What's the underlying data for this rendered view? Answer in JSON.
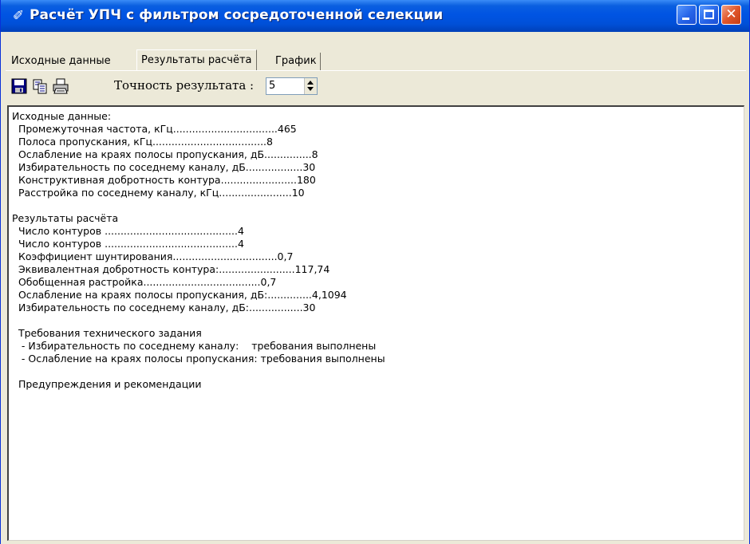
{
  "window": {
    "title": "Расчёт УПЧ с фильтром сосредоточенной селекции",
    "title_icon": "pencil-icon",
    "controls": [
      "minimize-icon",
      "maximize-icon",
      "close-icon"
    ]
  },
  "tabs": [
    {
      "label": "Исходные данные",
      "selected": false
    },
    {
      "label": "Результаты расчёта",
      "selected": true
    },
    {
      "label": "График",
      "selected": false
    }
  ],
  "toolbar": {
    "buttons": [
      "save-icon",
      "copy-icon",
      "print-icon"
    ],
    "precision_label": "Точность результата :",
    "precision_value": "5"
  },
  "results": {
    "text": "Исходные данные:\n  Промежуточная частота, кГц.................................465\n  Полоса пропускания, кГц....................................8\n  Ослабление на краях полосы пропускания, дБ...............8\n  Избирательность по соседнему каналу, дБ..................30\n  Конструктивная добротность контура........................180\n  Расстройка по соседнему каналу, кГц.......................10\n\nРезультаты расчёта\n  Число контуров ..........................................4\n  Число контуров ..........................................4\n  Коэффициент шунтирования.................................0,7\n  Эквивалентная добротность контура:........................117,74\n  Обобщенная растройка.....................................0,7\n  Ослабление на краях полосы пропускания, дБ:..............4,1094\n  Избирательность по соседнему каналу, дБ:.................30\n\n  Требования технического задания\n   - Избирательность по соседнему каналу:    требования выполнены\n   - Ослабление на краях полосы пропускания: требования выполнены\n\n  Предупреждения и рекомендации"
  },
  "colors": {
    "titlebar": "#0054e3",
    "close_button": "#e0562b",
    "window_face": "#ece9d8",
    "text_area": "#ffffff"
  }
}
